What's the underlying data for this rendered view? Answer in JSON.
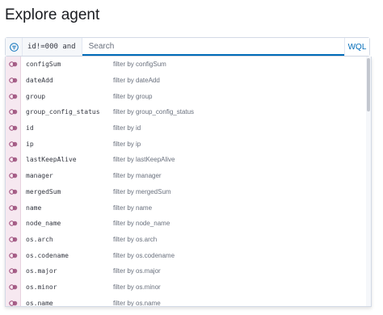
{
  "page": {
    "title": "Explore agent"
  },
  "search": {
    "query_prefix": "id!=000 and",
    "placeholder": "Search",
    "wql_label": "WQL",
    "filter_icon": "filter-icon"
  },
  "suggestions": [
    {
      "field": "configSum",
      "description": "filter by configSum"
    },
    {
      "field": "dateAdd",
      "description": "filter by dateAdd"
    },
    {
      "field": "group",
      "description": "filter by group"
    },
    {
      "field": "group_config_status",
      "description": "filter by group_config_status"
    },
    {
      "field": "id",
      "description": "filter by id"
    },
    {
      "field": "ip",
      "description": "filter by ip"
    },
    {
      "field": "lastKeepAlive",
      "description": "filter by lastKeepAlive"
    },
    {
      "field": "manager",
      "description": "filter by manager"
    },
    {
      "field": "mergedSum",
      "description": "filter by mergedSum"
    },
    {
      "field": "name",
      "description": "filter by name"
    },
    {
      "field": "node_name",
      "description": "filter by node_name"
    },
    {
      "field": "os.arch",
      "description": "filter by os.arch"
    },
    {
      "field": "os.codename",
      "description": "filter by os.codename"
    },
    {
      "field": "os.major",
      "description": "filter by os.major"
    },
    {
      "field": "os.minor",
      "description": "filter by os.minor"
    },
    {
      "field": "os.name",
      "description": "filter by os.name"
    }
  ],
  "colors": {
    "accent": "#006bb8",
    "field_type_strip": "#f6e8f0",
    "toggle_icon": "#9a4a78"
  }
}
